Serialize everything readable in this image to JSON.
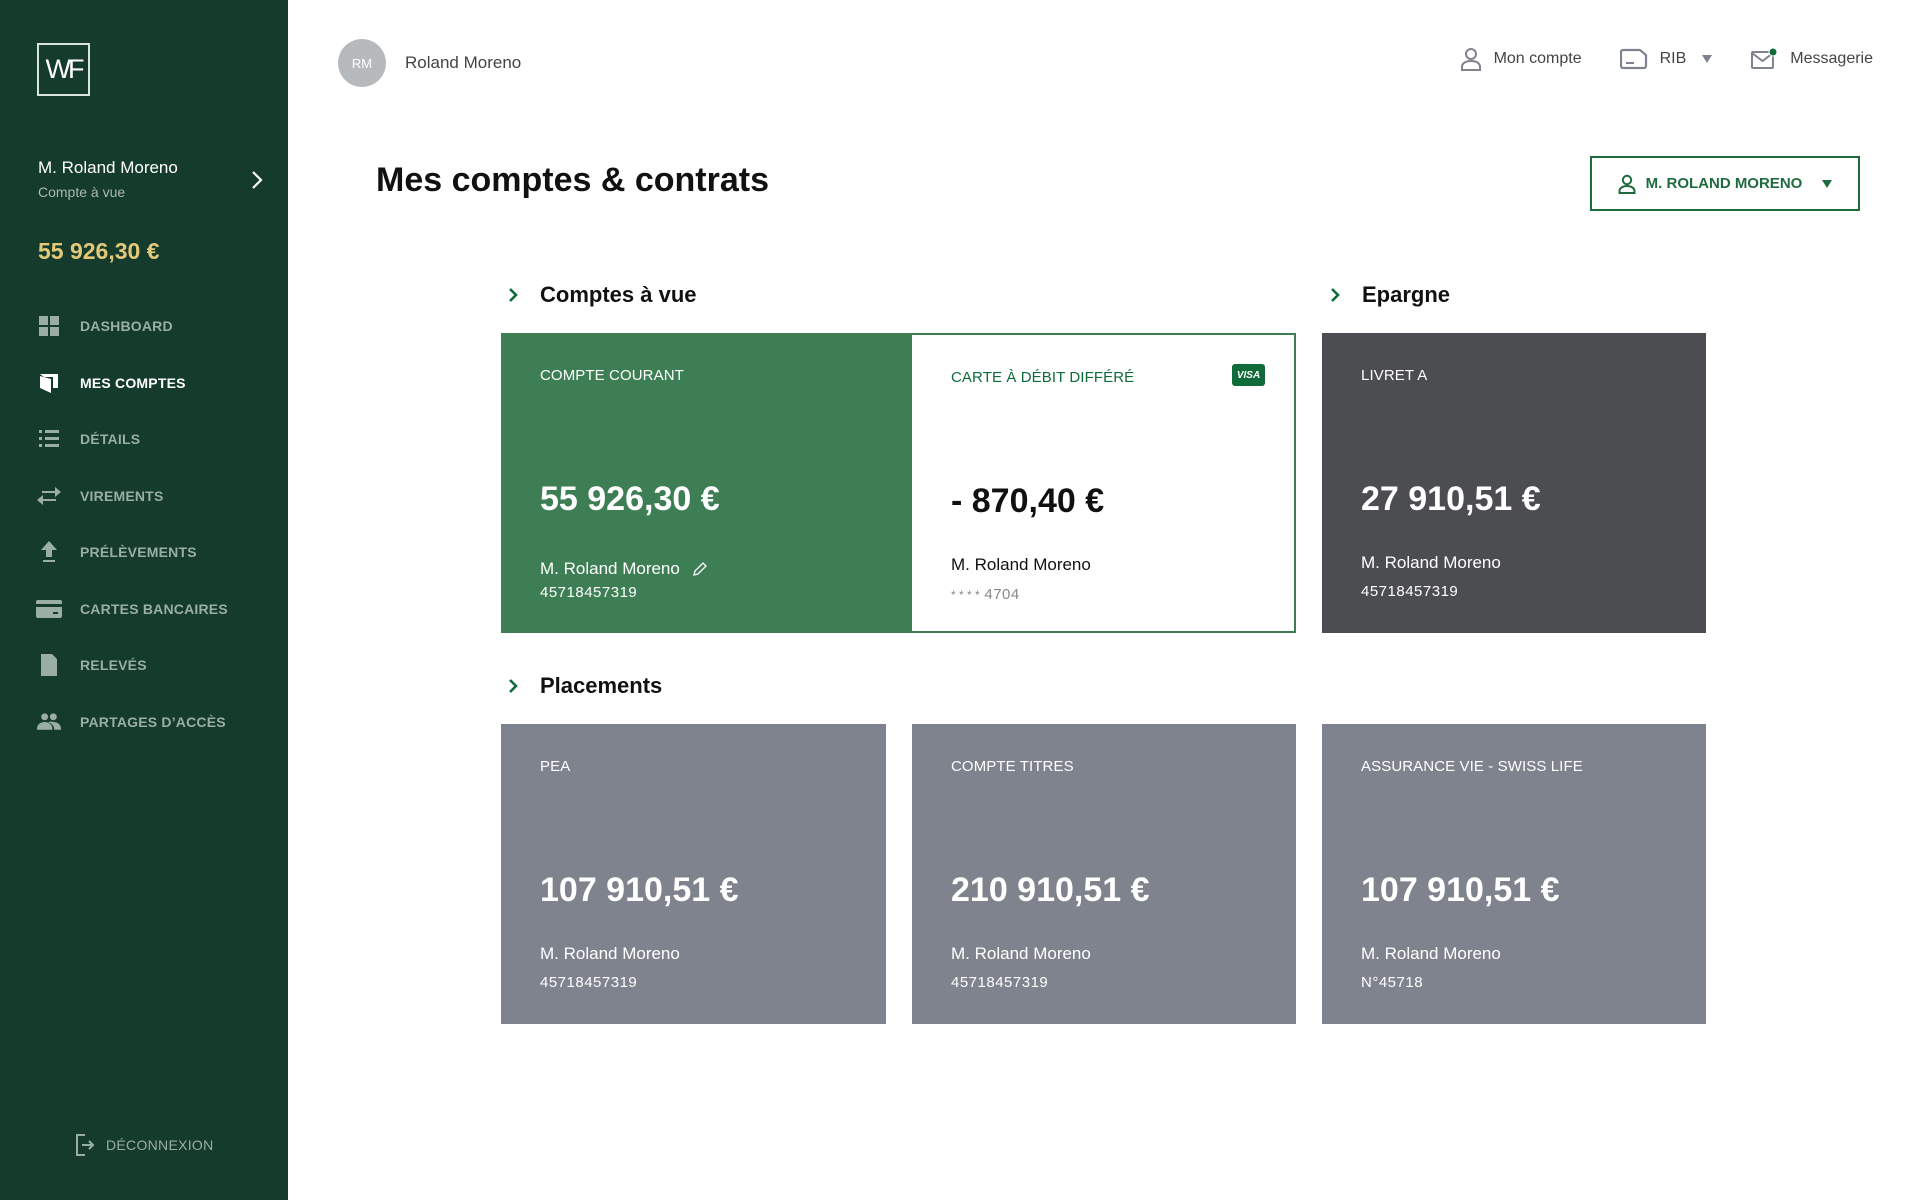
{
  "sidebar": {
    "logo": "WF",
    "user_name": "M. Roland Moreno",
    "user_subtitle": "Compte à vue",
    "balance": "55 926,30 €",
    "items": [
      {
        "label": "DASHBOARD",
        "icon": "dashboard-icon",
        "active": false
      },
      {
        "label": "MES COMPTES",
        "icon": "accounts-icon",
        "active": true
      },
      {
        "label": "DÉTAILS",
        "icon": "list-icon",
        "active": false
      },
      {
        "label": "VIREMENTS",
        "icon": "transfer-icon",
        "active": false
      },
      {
        "label": "PRÉLÈVEMENTS",
        "icon": "upload-icon",
        "active": false
      },
      {
        "label": "CARTES BANCAIRES",
        "icon": "credit-card-icon",
        "active": false
      },
      {
        "label": "RELEVÉS",
        "icon": "document-icon",
        "active": false
      },
      {
        "label": "PARTAGES D’ACCÈS",
        "icon": "users-icon",
        "active": false
      }
    ],
    "logout_label": "DÉCONNEXION"
  },
  "topbar": {
    "avatar_initials": "RM",
    "user_name": "Roland Moreno",
    "my_account_label": "Mon compte",
    "rib_label": "RIB",
    "messages_label": "Messagerie",
    "accent_color": "#0f6b3a"
  },
  "main": {
    "title": "Mes comptes & contrats",
    "account_selector": "M. ROLAND MORENO",
    "sections": {
      "current": {
        "title": "Comptes à vue",
        "cards": [
          {
            "type": "COMPTE COURANT",
            "amount": "55 926,30 €",
            "owner": "M. Roland Moreno",
            "number": "45718457319"
          },
          {
            "type": "CARTE À DÉBIT DIFFÉRÉ",
            "amount": "- 870,40 €",
            "owner": "M. Roland Moreno",
            "number_mask": "* * * *",
            "number": "4704",
            "badge": "VISA"
          }
        ]
      },
      "savings": {
        "title": "Epargne",
        "cards": [
          {
            "type": "LIVRET A",
            "amount": "27 910,51 €",
            "owner": "M. Roland Moreno",
            "number": "45718457319"
          }
        ]
      },
      "investments": {
        "title": "Placements",
        "cards": [
          {
            "type": "PEA",
            "amount": "107 910,51 €",
            "owner": "M. Roland Moreno",
            "number": "45718457319"
          },
          {
            "type": "COMPTE TITRES",
            "amount": "210 910,51 €",
            "owner": "M. Roland Moreno",
            "number": "45718457319"
          },
          {
            "type": "ASSURANCE VIE - SWISS LIFE",
            "amount": "107 910,51 €",
            "owner": "M. Roland Moreno",
            "number": "N°45718"
          }
        ]
      }
    }
  }
}
